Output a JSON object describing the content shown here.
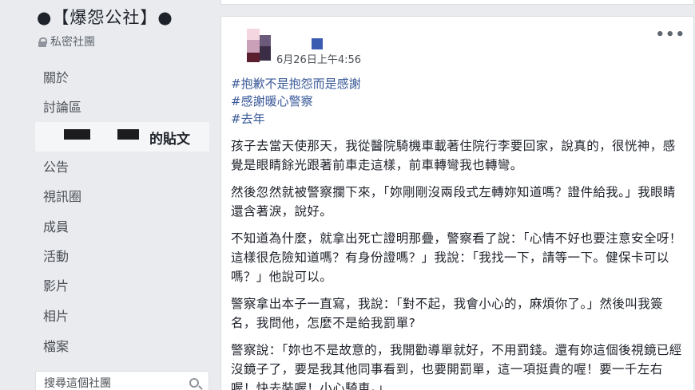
{
  "sidebar": {
    "group_title": "●【爆怨公社】●",
    "privacy": "私密社團",
    "items": [
      {
        "label": "關於"
      },
      {
        "label": "討論區"
      },
      {
        "label": "的貼文"
      },
      {
        "label": "公告"
      },
      {
        "label": "視訊圈"
      },
      {
        "label": "成員"
      },
      {
        "label": "活動"
      },
      {
        "label": "影片"
      },
      {
        "label": "相片"
      },
      {
        "label": "檔案"
      }
    ],
    "search_placeholder": "搜尋這個社團"
  },
  "post": {
    "timestamp": "6月26日上午4:56",
    "more": "•••",
    "hashtags": [
      "#抱歉不是抱怨而是感謝",
      "#感謝暖心警察",
      "#去年"
    ],
    "paragraphs": [
      "孩子去當天使那天，我從醫院騎機車載著住院行李要回家，說真的，很恍神，感覺是眼睛餘光跟著前車走這樣，前車轉彎我也轉彎。",
      "然後忽然就被警察攔下來，「妳剛剛沒兩段式左轉妳知道嗎？證件給我。」我眼睛還含著淚，說好。",
      "不知道為什麼，就拿出死亡證明那疊，警察看了說：「心情不好也要注意安全呀！這樣很危險知道嗎？有身份證嗎？」我說：「我找一下，請等一下。健保卡可以嗎？」他說可以。",
      "警察拿出本子一直寫，我說：「對不起，我會小心的，麻煩你了。」然後叫我簽名，我問他，怎麼不是給我罰單?",
      "警察說：「妳也不是故意的，我開勸導單就好，不用罰錢。還有妳這個後視鏡已經沒鏡子了，要是我其他同事看到，也要開罰單，這一項挺貴的喔！要一千左右喔！快去裝喔！小心騎車。」"
    ]
  }
}
